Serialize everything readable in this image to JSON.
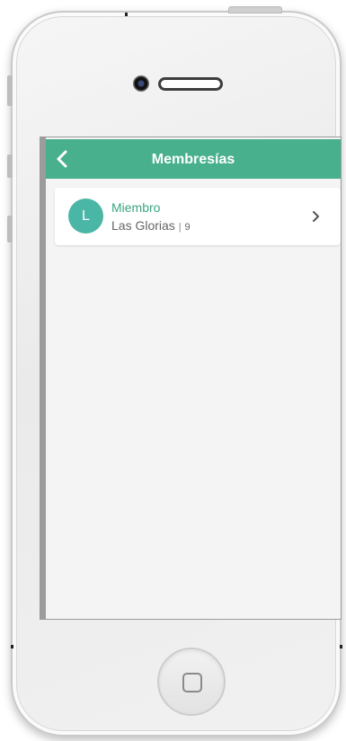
{
  "header": {
    "title": "Membresías",
    "back_icon": "chevron-left-icon"
  },
  "membership": {
    "avatar_letter": "L",
    "title": "Miembro",
    "location": "Las Glorias",
    "separator": "|",
    "count": "9",
    "chevron_icon": "chevron-right-icon"
  },
  "colors": {
    "header_bg": "#49b08e",
    "accent_text": "#3aa582",
    "avatar_bg": "#4ab6a6"
  }
}
